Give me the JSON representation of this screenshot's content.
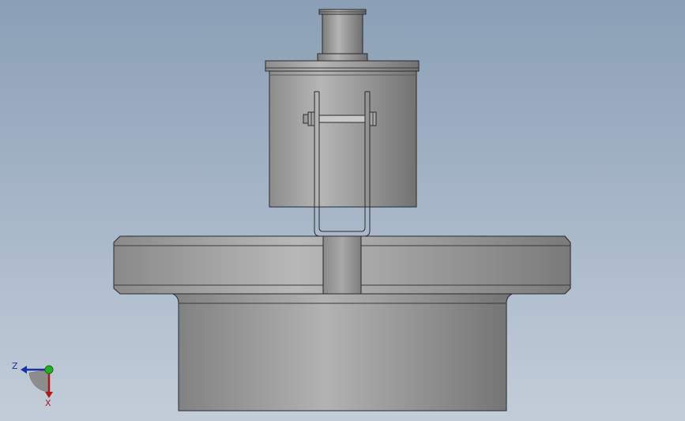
{
  "triad": {
    "z_label": "Z",
    "x_label": "X",
    "z_color": "#1b2fa8",
    "x_color": "#b01818",
    "y_color": "#22b022"
  },
  "model": {
    "steel_light": "#b4b4b4",
    "steel_dark": "#6a6a6a",
    "edge_color": "#2a2a2a"
  }
}
